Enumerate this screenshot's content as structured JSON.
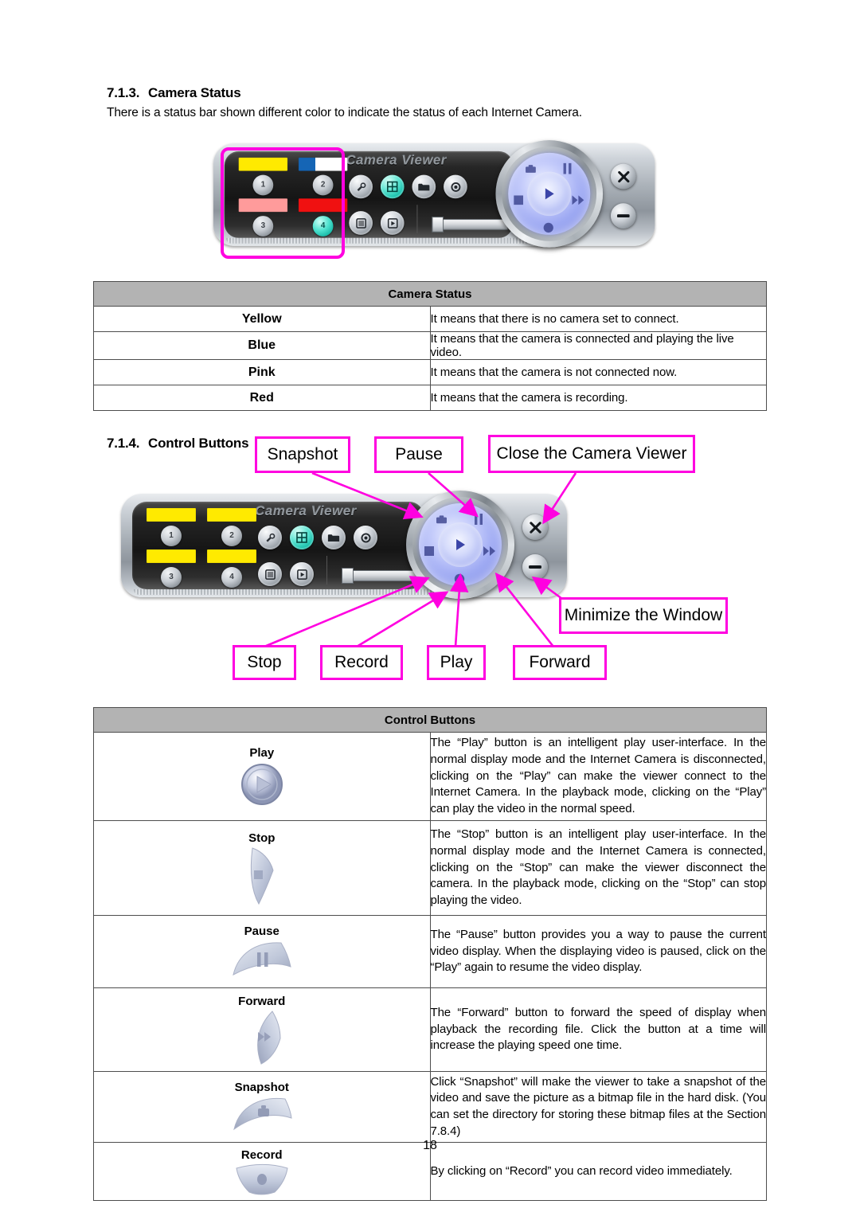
{
  "document": {
    "page_number": "18"
  },
  "section_camera_status": {
    "number": "7.1.3.",
    "title": "Camera Status",
    "intro": "There is a status bar shown different color to indicate the status of each Internet Camera."
  },
  "device_top": {
    "brand": "Camera Viewer",
    "status_bars": [
      {
        "slot": "1",
        "color_name": "Yellow",
        "hex": "#ffea00"
      },
      {
        "slot": "2",
        "color_name": "Blue",
        "hex": "#1565b5"
      },
      {
        "slot": "3",
        "color_name": "Pink",
        "hex": "#ff9b9b"
      },
      {
        "slot": "4",
        "color_name": "Red",
        "hex": "#f01111"
      }
    ],
    "camera_buttons": [
      "1",
      "2",
      "3",
      "4"
    ],
    "active_camera": "4"
  },
  "device_bottom": {
    "brand": "Camera Viewer",
    "status_bars": [
      {
        "slot": "1",
        "color_name": "Yellow",
        "hex": "#ffea00"
      },
      {
        "slot": "2",
        "color_name": "Yellow",
        "hex": "#ffea00"
      },
      {
        "slot": "3",
        "color_name": "Yellow",
        "hex": "#ffea00"
      },
      {
        "slot": "4",
        "color_name": "Yellow",
        "hex": "#ffea00"
      }
    ],
    "camera_buttons": [
      "1",
      "2",
      "3",
      "4"
    ]
  },
  "camera_status_table": {
    "title": "Camera Status",
    "rows": [
      {
        "label": "Yellow",
        "description": "It means that there is no camera set to connect."
      },
      {
        "label": "Blue",
        "description": "It means that the camera is connected and playing the live video."
      },
      {
        "label": "Pink",
        "description": "It means that the camera is not connected now."
      },
      {
        "label": "Red",
        "description": "It means that the camera is recording."
      }
    ]
  },
  "section_control_buttons": {
    "number": "7.1.4.",
    "title": "Control Buttons"
  },
  "callouts": {
    "snapshot": "Snapshot",
    "pause": "Pause",
    "close": "Close the Camera Viewer",
    "minimize": "Minimize the Window",
    "stop": "Stop",
    "record": "Record",
    "play": "Play",
    "forward": "Forward"
  },
  "control_buttons_table": {
    "title": "Control Buttons",
    "rows": [
      {
        "label": "Play",
        "icon": "play-round-icon",
        "description": "The “Play” button is an intelligent play user-interface. In the normal display mode and the Internet Camera is disconnected, clicking on the “Play” can make the viewer connect to the Internet Camera. In the playback mode, clicking on the “Play” can play the video in the normal speed."
      },
      {
        "label": "Stop",
        "icon": "stop-wedge-icon",
        "description": "The “Stop” button is an intelligent play user-interface. In the normal display mode and the Internet Camera is connected, clicking on the “Stop” can make the viewer disconnect the camera. In the playback mode, clicking on the “Stop” can stop playing the video."
      },
      {
        "label": "Pause",
        "icon": "pause-wedge-icon",
        "description": "The “Pause” button provides you a way to pause the current video display. When the displaying video is paused, click on the “Play” again to resume the video display."
      },
      {
        "label": "Forward",
        "icon": "forward-wedge-icon",
        "description": "The “Forward” button to forward the speed of display when playback the recording file. Click the button at a time will increase the playing speed one time."
      },
      {
        "label": "Snapshot",
        "icon": "snapshot-wedge-icon",
        "description": "Click “Snapshot” will make the viewer to take a snapshot of the video and save the picture as a bitmap file in the hard disk. (You can set the directory for storing these bitmap files at the Section 7.8.4)"
      },
      {
        "label": "Record",
        "icon": "record-wedge-icon",
        "description": "By clicking on “Record” you can record video immediately."
      }
    ]
  },
  "colors": {
    "callout_border": "#ff00e0",
    "table_header_bg": "#b3b3b3"
  }
}
